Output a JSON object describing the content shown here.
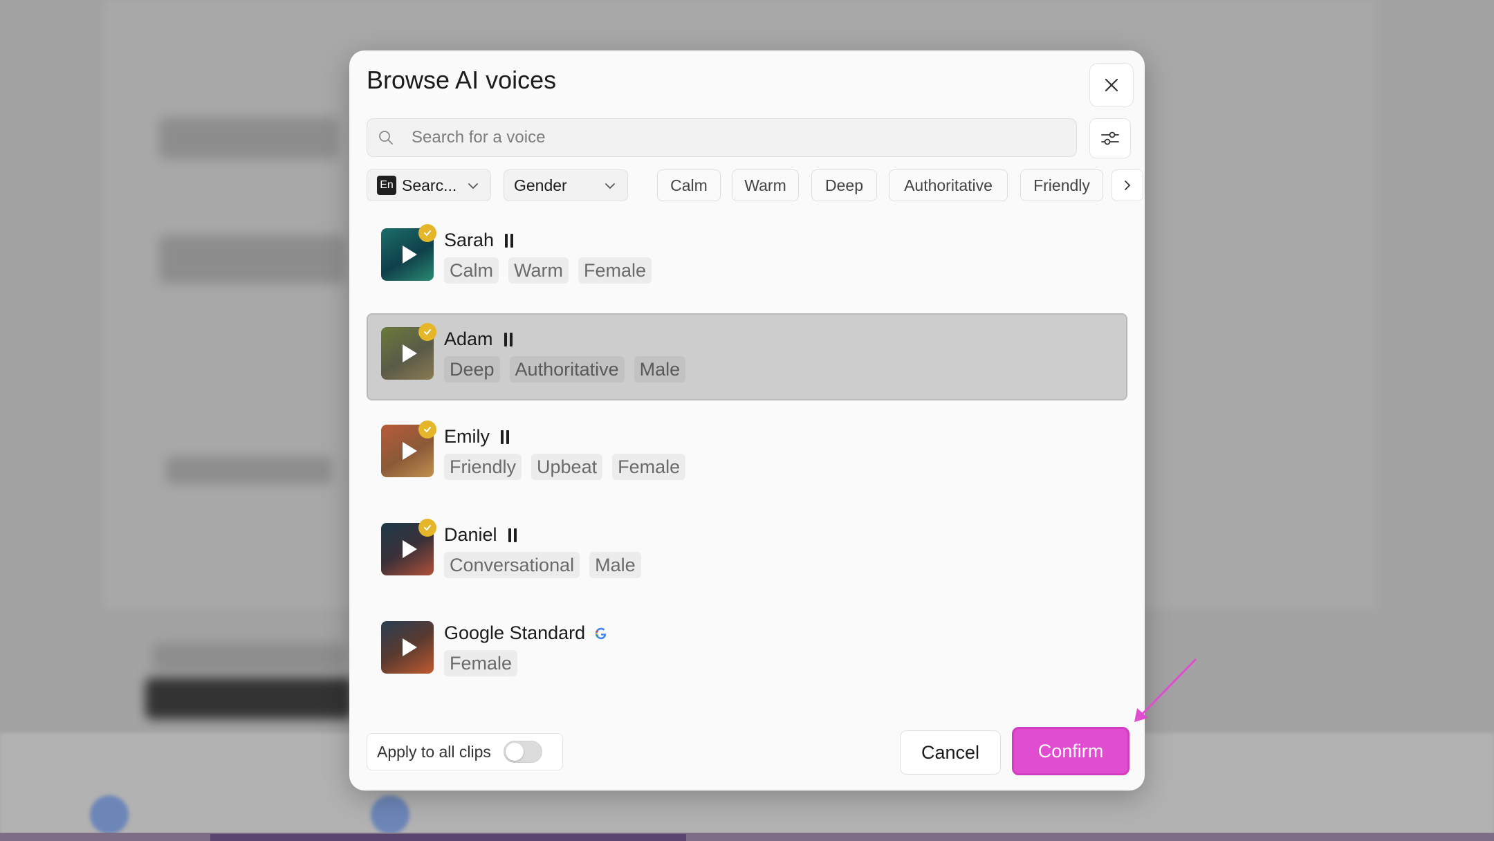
{
  "modal": {
    "title": "Browse AI voices",
    "search_placeholder": "Search for a voice",
    "language_badge": "En",
    "language_label": "Searc...",
    "gender_label": "Gender",
    "filter_chips": [
      "Calm",
      "Warm",
      "Deep",
      "Authoritative",
      "Friendly"
    ],
    "voices": [
      {
        "name": "Sarah",
        "tags": [
          "Calm",
          "Warm",
          "Female"
        ],
        "verified": true,
        "selected": false
      },
      {
        "name": "Adam",
        "tags": [
          "Deep",
          "Authoritative",
          "Male"
        ],
        "verified": true,
        "selected": true
      },
      {
        "name": "Emily",
        "tags": [
          "Friendly",
          "Upbeat",
          "Female"
        ],
        "verified": true,
        "selected": false
      },
      {
        "name": "Daniel",
        "tags": [
          "Conversational",
          "Male"
        ],
        "verified": true,
        "selected": false
      },
      {
        "name": "Google Standard",
        "tags": [
          "Female"
        ],
        "verified": false,
        "selected": false
      }
    ],
    "apply_label": "Apply to all clips",
    "apply_enabled": false,
    "cancel_label": "Cancel",
    "confirm_label": "Confirm"
  },
  "colors": {
    "accent": "#e14dd0",
    "verified": "#e5b52a",
    "selected_row": "#cdcdcd"
  },
  "icons": {
    "close": "close-icon",
    "search": "search-icon",
    "filter": "sliders-icon",
    "next": "chevron-right-icon",
    "play": "play-icon",
    "pause": "pause-icon",
    "verified": "check-badge-icon",
    "google": "google-icon"
  }
}
